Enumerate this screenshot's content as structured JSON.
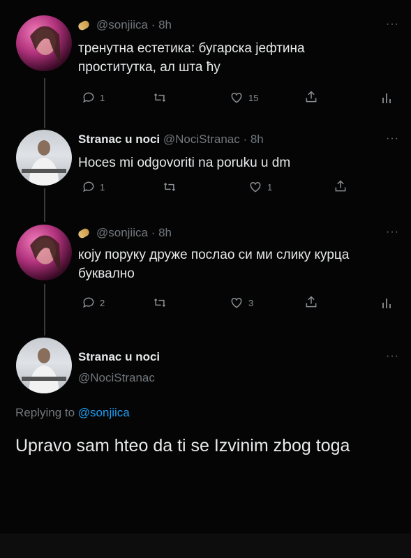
{
  "tweets": [
    {
      "emoji": "pill",
      "handle": "@sonjiica",
      "time": "· 8h",
      "more": "···",
      "text": "тренутна естетика: бугарска јефтина проститутка, ал шта ћу",
      "reply_count": "1",
      "retweet_count": "",
      "like_count": "15",
      "has_analytics": true
    },
    {
      "name": "Stranac u noci",
      "handle": "@NociStranac",
      "time": "· 8h",
      "more": "···",
      "text": "Hoces mi odgovoriti na poruku u dm",
      "reply_count": "1",
      "retweet_count": "",
      "like_count": "1",
      "has_analytics": false
    },
    {
      "emoji": "pill",
      "handle": "@sonjiica",
      "time": "· 8h",
      "more": "···",
      "text": "коју поруку друже послао си ми слику курца буквално",
      "reply_count": "2",
      "retweet_count": "",
      "like_count": "3",
      "has_analytics": true
    }
  ],
  "main_tweet": {
    "name": "Stranac u noci",
    "handle": "@NociStranac",
    "more": "···",
    "replying_prefix": "Replying to",
    "replying_to": "@sonjiica",
    "text": "Upravo sam hteo da ti se Izvinim zbog toga"
  },
  "colors": {
    "background": "#050505",
    "text": "#e7e9ea",
    "muted": "#71767b",
    "link": "#1d9bf0"
  }
}
